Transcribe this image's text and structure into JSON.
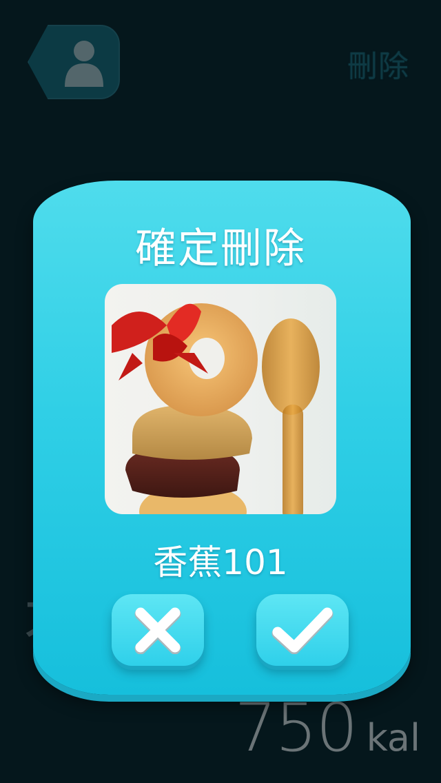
{
  "header": {
    "back_icon": "user-icon",
    "delete_label": "刪除"
  },
  "background": {
    "glyph": "不",
    "calories_value": "750",
    "calories_unit": "kal"
  },
  "dialog": {
    "title": "確定刪除",
    "item_name": "香蕉101",
    "cancel_icon": "close-icon",
    "confirm_icon": "check-icon"
  },
  "colors": {
    "accent": "#30cfe6",
    "background": "#05171c"
  }
}
